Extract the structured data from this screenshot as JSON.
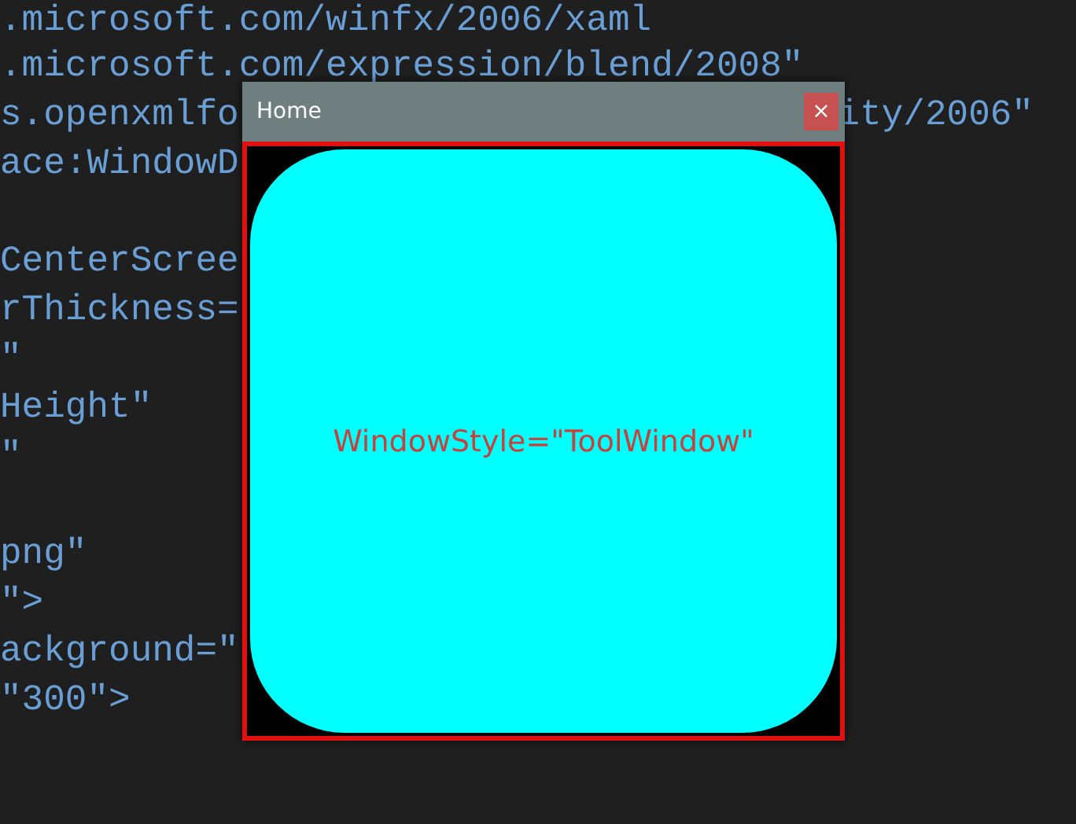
{
  "editor": {
    "lines": [
      {
        "segments": [
          ".microsoft.com/winfx/2006/xaml"
        ]
      },
      {
        "segments": [
          ".microsoft.com/expression/blend/2008\""
        ]
      },
      {
        "segments": [
          "s.openxmlfo",
          "ity/2006\""
        ]
      },
      {
        "segments": [
          "ace:WindowD"
        ]
      },
      {
        "segments": [
          "CenterScree"
        ],
        "blank_line_before": true
      },
      {
        "segments": [
          "rThickness="
        ]
      },
      {
        "segments": [
          "\""
        ]
      },
      {
        "segments": [
          "Height\""
        ]
      },
      {
        "segments": [
          "\""
        ]
      },
      {
        "segments": [
          "png\""
        ],
        "blank_line_before": true
      },
      {
        "segments": [
          "\">"
        ]
      },
      {
        "segments": [
          "ackground=\""
        ]
      },
      {
        "segments": [
          "\"300\">"
        ]
      }
    ]
  },
  "window": {
    "title": "Home",
    "close_button": "×",
    "content_text": "WindowStyle=\"ToolWindow\""
  }
}
